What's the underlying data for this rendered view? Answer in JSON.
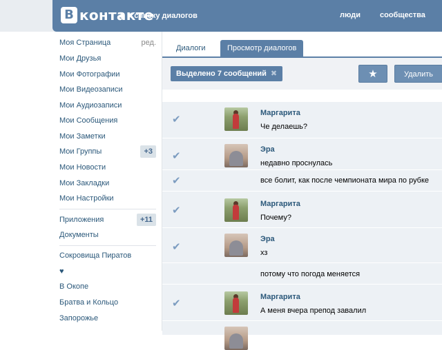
{
  "header": {
    "logo_letter": "В",
    "logo_text": "контакте",
    "back_label": "К списку диалогов",
    "nav": [
      "люди",
      "сообщества"
    ]
  },
  "sidebar": {
    "items": [
      {
        "label": "Моя Страница",
        "extra": "ред."
      },
      {
        "label": "Мои Друзья"
      },
      {
        "label": "Мои Фотографии"
      },
      {
        "label": "Мои Видеозаписи"
      },
      {
        "label": "Мои Аудиозаписи"
      },
      {
        "label": "Мои Сообщения"
      },
      {
        "label": "Мои Заметки"
      },
      {
        "label": "Мои Группы",
        "badge": "+3"
      },
      {
        "label": "Мои Новости"
      },
      {
        "label": "Мои Закладки"
      },
      {
        "label": "Мои Настройки"
      }
    ],
    "apps": [
      {
        "label": "Приложения",
        "badge": "+11"
      },
      {
        "label": "Документы"
      }
    ],
    "games": [
      {
        "label": "Сокровища Пиратов"
      },
      {
        "label": "♥"
      },
      {
        "label": "В Окопе"
      },
      {
        "label": "Братва и Кольцо"
      },
      {
        "label": "Запорожье"
      }
    ]
  },
  "tabs": [
    "Диалоги",
    "Просмотр диалогов"
  ],
  "toolbar": {
    "selected_label": "Выделено 7 сообщений",
    "close_glyph": "✖",
    "star_glyph": "★",
    "delete_label": "Удалить"
  },
  "messages": [
    {
      "author": "Маргарита",
      "text": "Че делаешь?",
      "avatar": "margarita"
    },
    {
      "author": "Эра",
      "text": "недавно проснулась",
      "avatar": "era"
    },
    {
      "author": "",
      "text": "все болит, как после чемпионата мира по рубке",
      "avatar": ""
    },
    {
      "author": "Маргарита",
      "text": "Почему?",
      "avatar": "margarita"
    },
    {
      "author": "Эра",
      "text": "хз",
      "avatar": "era"
    },
    {
      "author": "",
      "text": "потому что погода меняется",
      "avatar": ""
    },
    {
      "author": "Маргарита",
      "text": "А меня вчера препод завалил",
      "avatar": "margarita"
    }
  ],
  "check_glyph": "✔"
}
